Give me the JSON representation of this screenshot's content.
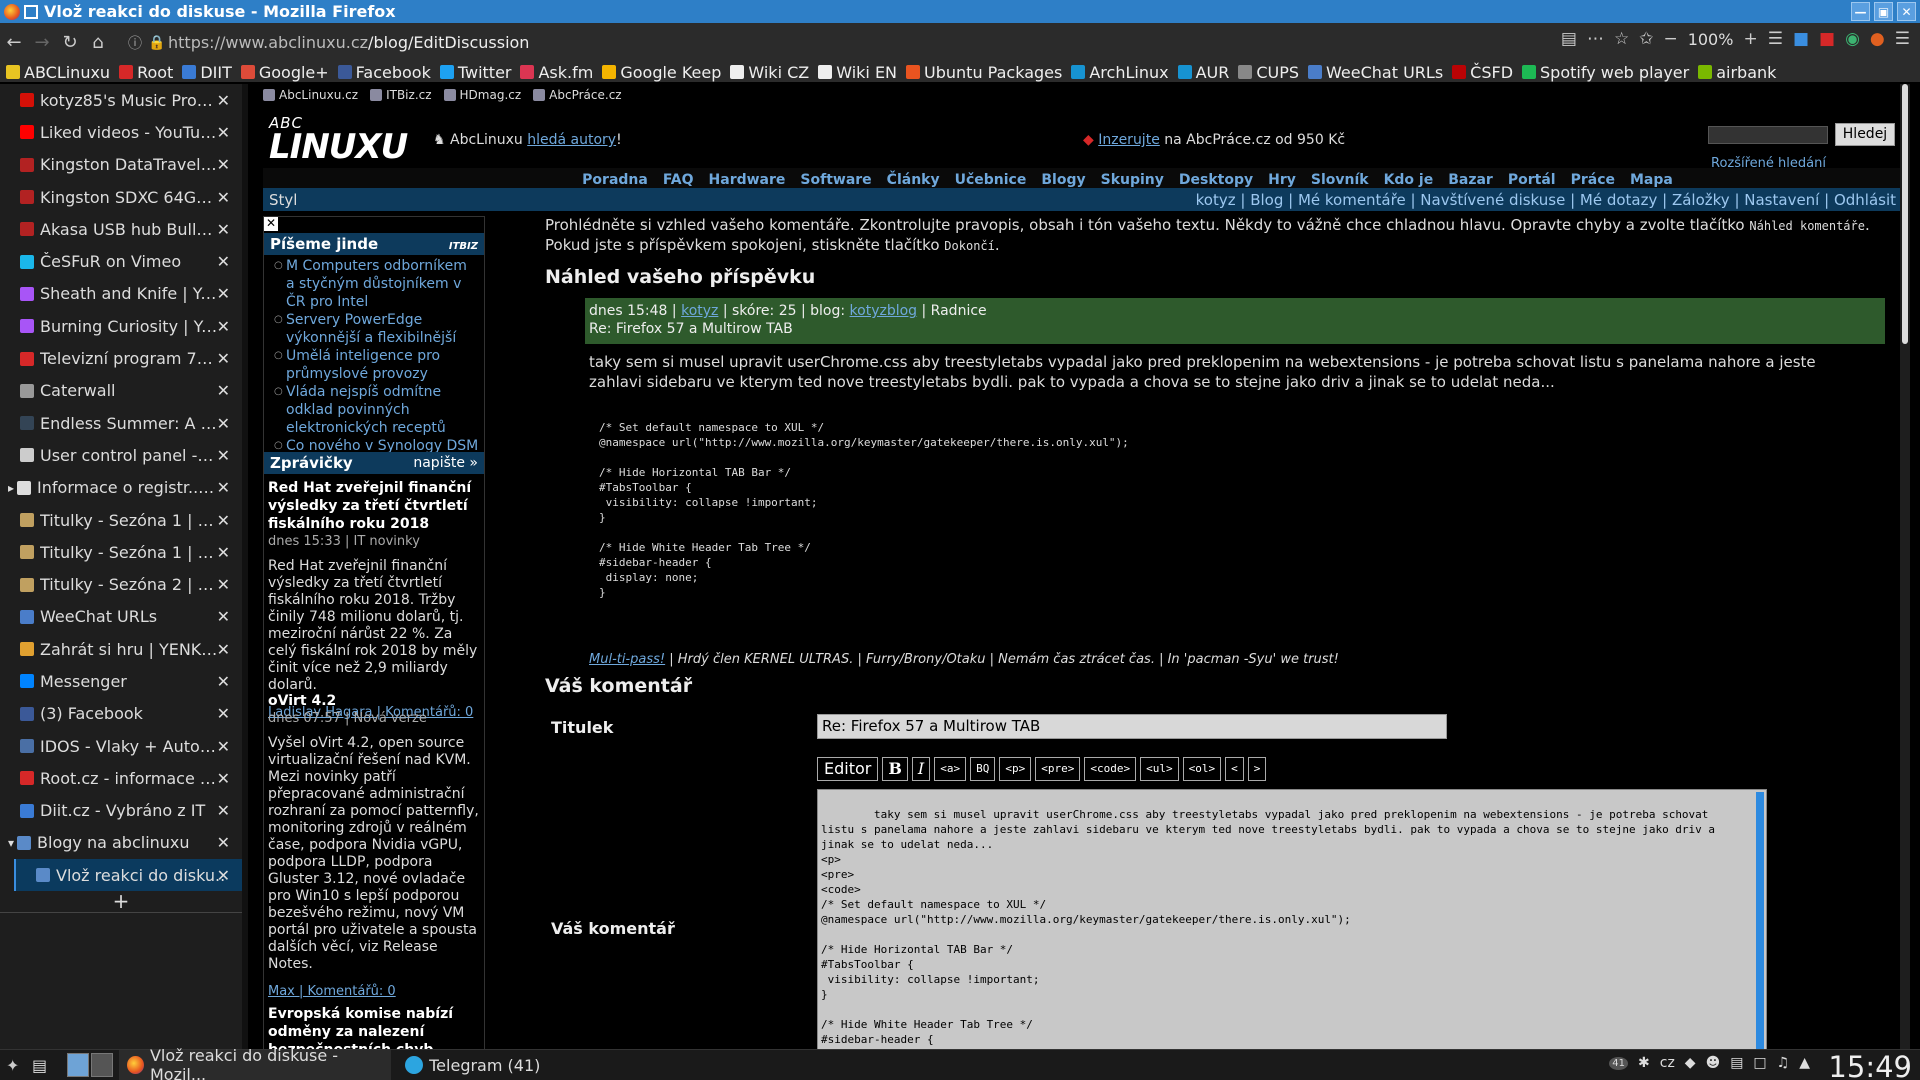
{
  "window": {
    "title": "Vlož reakci do diskuse - Mozilla Firefox"
  },
  "nav": {
    "url_host": "https://www.abclinuxu.cz",
    "url_path": "/blog/EditDiscussion",
    "zoom": "100%"
  },
  "bookmarks": [
    {
      "label": "ABCLinuxu",
      "color": "#e8c422"
    },
    {
      "label": "Root",
      "color": "#d62828"
    },
    {
      "label": "DIIT",
      "color": "#3a7bd5"
    },
    {
      "label": "Google+",
      "color": "#dd4b39"
    },
    {
      "label": "Facebook",
      "color": "#3b5998"
    },
    {
      "label": "Twitter",
      "color": "#1da1f2"
    },
    {
      "label": "Ask.fm",
      "color": "#db3552"
    },
    {
      "label": "Google Keep",
      "color": "#f4b400"
    },
    {
      "label": "Wiki CZ",
      "color": "#eeeeee"
    },
    {
      "label": "Wiki EN",
      "color": "#eeeeee"
    },
    {
      "label": "Ubuntu Packages",
      "color": "#e95420"
    },
    {
      "label": "ArchLinux",
      "color": "#1793d1"
    },
    {
      "label": "AUR",
      "color": "#1793d1"
    },
    {
      "label": "CUPS",
      "color": "#888888"
    },
    {
      "label": "WeeChat URLs",
      "color": "#4a7dc9"
    },
    {
      "label": "ČSFD",
      "color": "#ba0305"
    },
    {
      "label": "Spotify web player",
      "color": "#1db954"
    },
    {
      "label": "airbank",
      "color": "#7ab800"
    }
  ],
  "tabs": [
    {
      "label": "kotyz85's Music Profil..",
      "color": "#d51007",
      "kind": "normal"
    },
    {
      "label": "Liked videos - YouTube..",
      "color": "#ff0000",
      "kind": "normal"
    },
    {
      "label": "Kingston DataTraveler..",
      "color": "#b22222",
      "kind": "normal"
    },
    {
      "label": "Kingston SDXC 64GB ..",
      "color": "#b22222",
      "kind": "normal"
    },
    {
      "label": "Akasa USB hub Bullet,..",
      "color": "#b22222",
      "kind": "normal"
    },
    {
      "label": "ČeSFuR on Vimeo",
      "color": "#1ab7ea",
      "kind": "normal"
    },
    {
      "label": "Sheath and Knife | Ya..",
      "color": "#a855f7",
      "kind": "normal"
    },
    {
      "label": "Burning Curiosity | Ya..",
      "color": "#a855f7",
      "kind": "normal"
    },
    {
      "label": "Televizní program 712..",
      "color": "#d62828",
      "kind": "normal"
    },
    {
      "label": "Caterwall",
      "color": "#999999",
      "kind": "normal"
    },
    {
      "label": "Endless Summer: A M..",
      "color": "#334455",
      "kind": "normal"
    },
    {
      "label": "User control panel -- F..",
      "color": "#cccccc",
      "kind": "normal"
    },
    {
      "label": "Informace o registr.. (1)",
      "color": "#dddddd",
      "kind": "parent"
    },
    {
      "label": "Titulky - Sezóna 1 | St..",
      "color": "#c0a060",
      "kind": "normal"
    },
    {
      "label": "Titulky - Sezóna 1 | Th..",
      "color": "#c0a060",
      "kind": "normal"
    },
    {
      "label": "Titulky - Sezóna 2 | Th..",
      "color": "#c0a060",
      "kind": "normal"
    },
    {
      "label": "WeeChat URLs",
      "color": "#4a7dc9",
      "kind": "normal"
    },
    {
      "label": "Zahrát si hru | YENKEE..",
      "color": "#e0a030",
      "kind": "normal"
    },
    {
      "label": "Messenger",
      "color": "#0084ff",
      "kind": "normal"
    },
    {
      "label": "(3) Facebook",
      "color": "#3b5998",
      "kind": "normal"
    },
    {
      "label": "IDOS - Vlaky + Autob..",
      "color": "#4a6fa5",
      "kind": "normal"
    },
    {
      "label": "Root.cz - informace ne..",
      "color": "#d62828",
      "kind": "normal"
    },
    {
      "label": "Diit.cz - Vybráno z IT",
      "color": "#3a7bd5",
      "kind": "normal"
    },
    {
      "label": "Blogy na abclinuxu",
      "color": "#5a8ac8",
      "kind": "open"
    },
    {
      "label": "Vlož reakci do disku..",
      "color": "#5a8ac8",
      "kind": "active"
    }
  ],
  "site": {
    "mini_tabs": [
      "AbcLinuxu.cz",
      "ITBiz.cz",
      "HDmag.cz",
      "AbcPráce.cz"
    ],
    "logo_small": "ABC",
    "logo_big": "LINUXU",
    "hledaji_prefix": "AbcLinuxu ",
    "hledaji_link": "hledá autory",
    "hledaji_suffix": "!",
    "inzerujte_link": "Inzerujte",
    "inzerujte_suffix": " na AbcPráce.cz od 950 Kč",
    "search_button": "Hledej",
    "advanced_search": "Rozšířené hledání",
    "menu": [
      "Poradna",
      "FAQ",
      "Hardware",
      "Software",
      "Články",
      "Učebnice",
      "Blogy",
      "Skupiny",
      "Desktopy",
      "Hry",
      "Slovník",
      "Kdo je",
      "Bazar",
      "Portál",
      "Práce",
      "Mapa"
    ],
    "styl": "Styl",
    "user_links": "kotyz | Blog | Mé komentáře | Navštívené diskuse | Mé dotazy | Záložky | Nastavení | Odhlásit"
  },
  "left": {
    "pisemejinde_title": "Píšeme jinde",
    "itbiz": "ITBIZ",
    "pisemejinde": [
      "M Computers odborníkem a styčným důstojníkem v ČR pro Intel",
      "Servery PowerEdge výkonnější a flexibilnější",
      "Umělá inteligence pro průmyslové provozy",
      "Vláda nejspíš odmítne odklad povinných elektronických receptů",
      "Co nového v Synology DSM 6.2?"
    ],
    "zpravicky_title": "Zprávičky",
    "napiste": "napište »",
    "news1_title": "Red Hat zveřejnil finanční výsledky za třetí čtvrtletí fiskálního roku 2018",
    "news1_meta": "dnes 15:33 | IT novinky",
    "news1_body": "Red Hat zveřejnil finanční výsledky za třetí čtvrtletí fiskálního roku 2018. Tržby činily 748 milionu dolarů, tj. meziroční nárůst 22 %. Za celý fiskální rok 2018 by měly činit více než 2,9 miliardy dolarů.",
    "news1_footer": "Ladislav Hagara | Komentářů: 0",
    "news2_title": "oVirt 4.2",
    "news2_meta": "dnes 07:57 | Nová verze",
    "news2_body": "Vyšel oVirt 4.2, open source virtualizační řešení nad KVM. Mezi novinky patří přepracované administrační rozhraní za pomocí patternfly, monitoring zdrojů v reálném čase, podpora Nvidia vGPU, podpora LLDP, podpora Gluster 3.12, nové ovladače pro Win10 s lepší podporou bezešvého režimu, nový VM portál pro uživatele a spousta dalších věcí, viz Release Notes.",
    "news2_footer": "Max | Komentářů: 0",
    "news3_title": "Evropská komise nabízí odměny za nalezení bezpečnostních chyb"
  },
  "main": {
    "intro": "Prohlédněte si vzhled vašeho komentáře. Zkontrolujte pravopis, obsah i tón vašeho textu. Někdy to vážně chce chladnou hlavu. Opravte chyby a zvolte tlačítko",
    "intro_code1": "Náhled komentáře",
    "intro_mid": ". Pokud jste s příspěvkem spokojeni, stiskněte tlačítko",
    "intro_code2": "Dokončí",
    "intro_end": ".",
    "preview_title": "Náhled vašeho příspěvku",
    "comment_meta_prefix": "dnes 15:48 | ",
    "comment_author": "kotyz",
    "comment_meta_mid": " | skóre: 25 | blog: ",
    "comment_blog": "kotyzblog",
    "comment_meta_end": " | Radnice",
    "comment_subject": "Re: Firefox 57 a Multirow TAB",
    "comment_body": "taky sem si musel upravit userChrome.css aby treestyletabs vypadal jako pred preklopenim na webextensions - je potreba schovat listu s panelama nahore a jeste zahlavi sidebaru ve kterym ted nove treestyletabs bydli. pak to vypada a chova se to stejne jako driv a jinak se to udelat neda...",
    "comment_code": "/* Set default namespace to XUL */\n@namespace url(\"http://www.mozilla.org/keymaster/gatekeeper/there.is.only.xul\");\n\n/* Hide Horizontal TAB Bar */\n#TabsToolbar {\n visibility: collapse !important;\n}\n\n/* Hide White Header Tab Tree */\n#sidebar-header {\n display: none;\n}",
    "sig_link": "Mul-ti-pass!",
    "sig_text": " | Hrdý člen KERNEL ULTRAS. | Furry/Brony/Otaku | Nemám čas ztrácet čas. | In 'pacman -Syu' we trust!",
    "form_title": "Váš komentář",
    "titulek_label": "Titulek",
    "titulek_value": "Re: Firefox 57 a Multirow TAB",
    "editor_buttons": [
      "Editor",
      "B",
      "I",
      "<a>",
      "BQ",
      "<p>",
      "<pre>",
      "<code>",
      "<ul>",
      "<ol>",
      "<",
      ">"
    ],
    "komentar_label": "Váš komentář",
    "textarea_value": "taky sem si musel upravit userChrome.css aby treestyletabs vypadal jako pred preklopenim na webextensions - je potreba schovat listu s panelama nahore a jeste zahlavi sidebaru ve kterym ted nove treestyletabs bydli. pak to vypada a chova se to stejne jako driv a jinak se to udelat neda...\n<p>\n<pre>\n<code>\n/* Set default namespace to XUL */\n@namespace url(\"http://www.mozilla.org/keymaster/gatekeeper/there.is.only.xul\");\n\n/* Hide Horizontal TAB Bar */\n#TabsToolbar {\n visibility: collapse !important;\n}\n\n/* Hide White Header Tab Tree */\n#sidebar-header {\n display: none;\n}"
  },
  "taskbar": {
    "task_firefox": "Vlož reakci do diskuse - Mozil...",
    "task_telegram": "Telegram (41)",
    "tray_badge": "41",
    "keyboard": "cz",
    "clock": "15:49"
  }
}
